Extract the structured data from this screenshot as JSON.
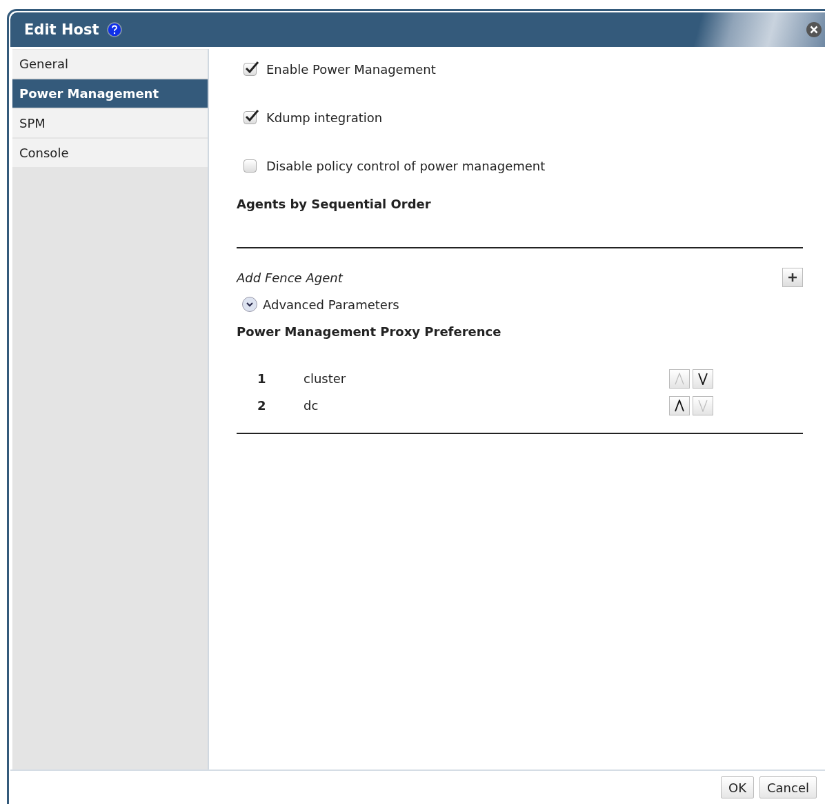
{
  "window": {
    "title": "Edit Host"
  },
  "sidebar": {
    "items": [
      {
        "label": "General",
        "selected": false
      },
      {
        "label": "Power Management",
        "selected": true
      },
      {
        "label": "SPM",
        "selected": false
      },
      {
        "label": "Console",
        "selected": false
      }
    ]
  },
  "options": [
    {
      "label": "Enable Power Management",
      "checked": true
    },
    {
      "label": "Kdump integration",
      "checked": true
    },
    {
      "label": "Disable policy control of power management",
      "checked": false
    }
  ],
  "agents": {
    "title": "Agents by Sequential Order",
    "add_label": "Add Fence Agent"
  },
  "advanced": {
    "label": "Advanced Parameters",
    "expanded": false
  },
  "proxy": {
    "title": "Power Management Proxy Preference",
    "rows": [
      {
        "order": "1",
        "name": "cluster",
        "up_disabled": true,
        "down_disabled": false
      },
      {
        "order": "2",
        "name": "dc",
        "up_disabled": false,
        "down_disabled": true
      }
    ]
  },
  "buttons": [
    "OK",
    "Cancel"
  ]
}
